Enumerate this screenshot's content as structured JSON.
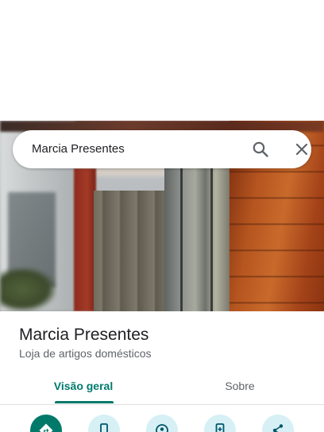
{
  "search": {
    "query": "Marcia Presentes"
  },
  "place": {
    "name": "Marcia Presentes",
    "category": "Loja de artigos domésticos"
  },
  "tabs": [
    {
      "label": "Visão geral",
      "selected": true
    },
    {
      "label": "Sobre",
      "selected": false
    }
  ],
  "actions": [
    {
      "icon": "directions-icon"
    },
    {
      "icon": "phone-icon"
    },
    {
      "icon": "location-icon"
    },
    {
      "icon": "add-to-phone-icon"
    },
    {
      "icon": "share-icon"
    }
  ],
  "colors": {
    "accent": "#00796b",
    "action_bg": "#d6f0f5",
    "text_primary": "#202124",
    "text_secondary": "#5f6368"
  }
}
